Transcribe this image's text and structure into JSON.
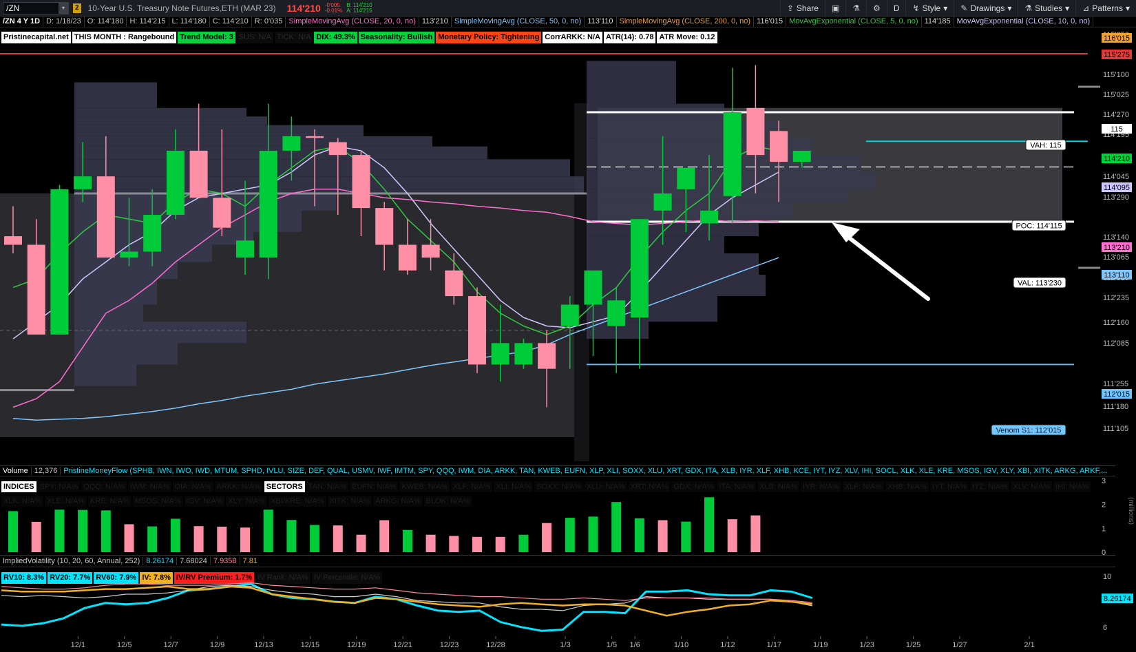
{
  "toolbar": {
    "symbol": "/ZN",
    "link_badge": "2",
    "description": "10-Year U.S. Treasury Note Futures,ETH (MAR 23)",
    "last_price": "114'210",
    "change_net": "-0'005",
    "change_pct": "-0.01%",
    "bid": "B: 114'210",
    "ask": "A: 114'215",
    "buttons": {
      "share": "Share",
      "style": "Style",
      "drawings": "Drawings",
      "studies": "Studies",
      "patterns": "Patterns",
      "interval": "D"
    }
  },
  "studybar": {
    "chart_label": "/ZN 4 Y 1D",
    "date": "D: 1/18/23",
    "open": "O: 114'180",
    "high": "H: 114'215",
    "low": "L: 114'180",
    "close": "C: 114'210",
    "range": "R: 0'035",
    "studies": [
      {
        "label": "SimpleMovingAvg (CLOSE, 20, 0, no)",
        "value": "113'210",
        "color": "#ff6ed0"
      },
      {
        "label": "SimpleMovingAvg (CLOSE, 50, 0, no)",
        "value": "113'110",
        "color": "#7ec8ff"
      },
      {
        "label": "SimpleMovingAvg (CLOSE, 200, 0, no)",
        "value": "116'015",
        "color": "#f0a030"
      },
      {
        "label": "MovAvgExponential (CLOSE, 5, 0, no)",
        "value": "114'185",
        "color": "#2ecc40"
      },
      {
        "label": "MovAvgExponential (CLOSE, 10, 0, no)",
        "value": "",
        "color": "#cfc8ff"
      }
    ]
  },
  "info_labels": [
    {
      "text": "Pristinecapital.net",
      "bg": "#ffffff",
      "fg": "#000000"
    },
    {
      "text": "THIS MONTH : Rangebound",
      "bg": "#ffffff",
      "fg": "#000000"
    },
    {
      "text": "Trend Model: 3",
      "bg": "#00d43c",
      "fg": "#000000"
    },
    {
      "text": "SUS: N/A",
      "bg": "#0b0b0b",
      "fg": "#2a2a2a"
    },
    {
      "text": "TICK: N/A",
      "bg": "#0b0b0b",
      "fg": "#2a2a2a"
    },
    {
      "text": "DIX: 49.3%",
      "bg": "#00d43c",
      "fg": "#000000"
    },
    {
      "text": "Seasonality: Bullish",
      "bg": "#00d43c",
      "fg": "#000000"
    },
    {
      "text": "Monetary Policy: Tightening",
      "bg": "#ff4513",
      "fg": "#000000"
    },
    {
      "text": "CorrARKK: N/A",
      "bg": "#ffffff",
      "fg": "#000000"
    },
    {
      "text": "ATR(14): 0.78",
      "bg": "#ffffff",
      "fg": "#000000"
    },
    {
      "text": "ATR Move: 0.12",
      "bg": "#ffffff",
      "fg": "#000000"
    }
  ],
  "price_axis": {
    "ticks": [
      "115'250",
      "115'175",
      "115'100",
      "115'025",
      "114'270",
      "114'195",
      "114'045",
      "113'290",
      "113'140",
      "113'065",
      "112'310",
      "112'235",
      "112'160",
      "112'085",
      "111'255",
      "111'180",
      "111'105"
    ],
    "badges": [
      {
        "text": "116'015",
        "bg": "#f0a030",
        "fg": "#000000"
      },
      {
        "text": "115'275",
        "bg": "#e23a3a",
        "fg": "#000000"
      },
      {
        "text": "115",
        "bg": "#ffffff",
        "fg": "#000000"
      },
      {
        "text": "114'210",
        "bg": "#00d43c",
        "fg": "#000000"
      },
      {
        "text": "114'095",
        "bg": "#cfc8ff",
        "fg": "#000000"
      },
      {
        "text": "113'210",
        "bg": "#ff6ed0",
        "fg": "#000000"
      },
      {
        "text": "113'110",
        "bg": "#7ec8ff",
        "fg": "#000000"
      },
      {
        "text": "112'015",
        "bg": "#6fc3ff",
        "fg": "#000000"
      }
    ]
  },
  "levels": {
    "vah": "VAH: 115",
    "poc": "POC: 114'115",
    "val": "VAL: 113'230",
    "venom": "Venom S1: 112'015"
  },
  "x_axis": [
    "12/1",
    "12/5",
    "12/7",
    "12/9",
    "12/13",
    "12/15",
    "12/19",
    "12/21",
    "12/23",
    "12/28",
    "1/3",
    "1/5",
    "1/6",
    "1/10",
    "1/12",
    "1/17",
    "1/19",
    "1/23",
    "1/25",
    "1/27",
    "2/1"
  ],
  "volume": {
    "title": "Volume",
    "value": "12,376",
    "moneyflow": "PristineMoneyFlow (SPHB, IWN, IWO, IWD, MTUM, SPHD, IVLU, SIZE, DEF, QUAL, USMV, IWF, IMTM, SPY, QQQ, IWM, DIA, ARKK, TAN, KWEB, EUFN, XLP, XLI, SOXX, XLU, XRT, GDX, ITA, XLB, IYR, XLF, XHB, KCE, IYT, IYZ, XLV, IHI, SOCL, XLK, XLE, KRE, MSOS, IGV, XLY, XBI, XITK, ARKG, ARKF,...",
    "axis": [
      "3",
      "2",
      "1",
      "0"
    ],
    "unit": "(millions)"
  },
  "indices_row": {
    "head": "INDICES",
    "items": [
      "SPY: N/A%",
      "QQQ: N/A%",
      "IWM: N/A%",
      "DIA: N/A%",
      "ARKK: N/A%"
    ]
  },
  "sectors_row": {
    "head": "SECTORS",
    "items": [
      "TAN: N/A%",
      "EUFN: N/A%",
      "KWEB: N/A%",
      "XLF: N/A%",
      "XLI: N/A%",
      "SOXX: N/A%",
      "XLU: N/A%",
      "XRT: N/A%",
      "GDX: N/A%",
      "ITA: N/A%",
      "XLB: N/A%",
      "IYR: N/A%",
      "XLF: N/A%",
      "XHB: N/A%",
      "IYT: N/A%",
      "IYZ: N/A%",
      "XLV: N/A%",
      "IHI: N/A%"
    ]
  },
  "third_row": {
    "items": [
      "XLK: N/A%",
      "XLE: N/A%",
      "KRE: N/A%",
      "MSOS: N/A%",
      "IGV: N/A%",
      "XLY: N/A%",
      "XBI/KRE: N/A%",
      "XITK: N/A%",
      "ARKG: N/A%",
      "BLOK: N/A%"
    ]
  },
  "iv": {
    "title": "ImpliedVolatility (10, 20, 60, Annual, 252)",
    "values": [
      {
        "text": "8.26174",
        "color": "#00e5ff"
      },
      {
        "text": "7.68024",
        "color": "#cccccc"
      },
      {
        "text": "7.9358",
        "color": "#ff8aa0"
      },
      {
        "text": "7.81",
        "color": "#f0b020"
      }
    ],
    "labels": [
      {
        "text": "RV10: 8.3%",
        "bg": "#00e5ff",
        "fg": "#000000"
      },
      {
        "text": "RV20: 7.7%",
        "bg": "#00e5ff",
        "fg": "#000000"
      },
      {
        "text": "RV60: 7.9%",
        "bg": "#00e5ff",
        "fg": "#000000"
      },
      {
        "text": "IV: 7.8%",
        "bg": "#f0b020",
        "fg": "#000000"
      },
      {
        "text": "IV/RV Premium: 1.7%",
        "bg": "#ff1e1e",
        "fg": "#000000"
      },
      {
        "text": "IV Rank: N/A%",
        "bg": "#0b0b0b",
        "fg": "#262626"
      },
      {
        "text": "IV Percentile: N/A%",
        "bg": "#0b0b0b",
        "fg": "#262626"
      }
    ],
    "axis": [
      "10",
      "8.26174",
      "6"
    ]
  },
  "chart_data": [
    {
      "type": "candlestick",
      "title": "/ZN 4 Y 1D",
      "note": "prices in points (decimal of 32nds); values estimated from axis",
      "ylim": [
        111.2,
        115.95
      ],
      "categories": [
        "11/28",
        "11/29",
        "11/30",
        "12/1",
        "12/2",
        "12/5",
        "12/6",
        "12/7",
        "12/8",
        "12/9",
        "12/12",
        "12/13",
        "12/14",
        "12/15",
        "12/16",
        "12/19",
        "12/20",
        "12/21",
        "12/22",
        "12/23",
        "12/27",
        "12/28",
        "12/29",
        "12/30",
        "1/3",
        "1/4",
        "1/5",
        "1/6",
        "1/9",
        "1/10",
        "1/11",
        "1/12",
        "1/13",
        "1/17",
        "1/18"
      ],
      "open": [
        113.55,
        113.45,
        112.4,
        114.1,
        114.25,
        113.3,
        113.37,
        113.8,
        114.55,
        114.0,
        113.3,
        113.3,
        114.55,
        114.72,
        114.65,
        114.5,
        113.88,
        113.45,
        113.45,
        113.15,
        112.85,
        112.05,
        112.05,
        112.3,
        112.5,
        112.75,
        112.5,
        112.6,
        113.85,
        114.1,
        113.7,
        114.02,
        115.05,
        114.78,
        114.42
      ],
      "high": [
        113.9,
        113.75,
        114.15,
        114.65,
        114.72,
        114.0,
        114.1,
        114.8,
        115.1,
        114.8,
        114.2,
        115.1,
        114.95,
        114.8,
        114.7,
        114.55,
        113.95,
        113.75,
        113.75,
        113.35,
        112.95,
        112.75,
        112.35,
        112.45,
        112.85,
        113.05,
        112.95,
        113.7,
        114.72,
        114.3,
        114.5,
        115.52,
        115.55,
        114.9,
        114.42
      ],
      "low": [
        113.35,
        113.0,
        112.4,
        113.95,
        113.75,
        113.2,
        113.2,
        113.75,
        114.0,
        113.55,
        113.1,
        113.05,
        114.2,
        113.9,
        113.8,
        113.55,
        113.15,
        113.1,
        113.15,
        112.75,
        111.95,
        111.85,
        112.0,
        111.55,
        112.0,
        112.15,
        111.95,
        112.0,
        113.45,
        113.6,
        113.5,
        113.7,
        114.05,
        113.95,
        114.35
      ],
      "close": [
        113.45,
        112.4,
        114.1,
        114.25,
        113.3,
        113.37,
        113.8,
        114.55,
        114.0,
        113.65,
        113.5,
        114.55,
        114.72,
        114.7,
        114.5,
        113.88,
        113.45,
        113.15,
        113.3,
        112.85,
        112.05,
        112.3,
        112.3,
        112.0,
        112.75,
        113.15,
        112.8,
        113.75,
        114.05,
        114.35,
        113.85,
        115.0,
        114.5,
        114.42,
        114.55
      ]
    },
    {
      "type": "bar",
      "title": "Volume",
      "ylabel": "(millions)",
      "ylim": [
        0,
        3
      ],
      "values": [
        1.72,
        1.27,
        1.78,
        1.77,
        1.75,
        1.17,
        1.08,
        1.4,
        1.09,
        1.07,
        1.03,
        1.78,
        1.35,
        1.14,
        1.12,
        0.73,
        1.34,
        0.93,
        0.73,
        0.68,
        0.64,
        0.64,
        0.73,
        1.22,
        1.44,
        1.49,
        2.1,
        1.42,
        1.34,
        1.28,
        2.3,
        1.38,
        1.54
      ],
      "colors": [
        "up",
        "down",
        "up",
        "up",
        "up",
        "down",
        "up",
        "up",
        "down",
        "down",
        "down",
        "up",
        "up",
        "up",
        "down",
        "down",
        "down",
        "up",
        "down",
        "down",
        "down",
        "down",
        "up",
        "down",
        "up",
        "up",
        "up",
        "up",
        "down",
        "up",
        "up",
        "down",
        "down"
      ]
    },
    {
      "type": "line",
      "title": "ImpliedVolatility (10, 20, 60, Annual, 252)",
      "ylim": [
        5.5,
        10.5
      ],
      "series": [
        {
          "name": "RV10",
          "color": "#00e5ff",
          "values": [
            6.2,
            6.1,
            6.3,
            6.7,
            7.5,
            7.9,
            7.8,
            7.9,
            8.3,
            8.9,
            9.0,
            9.2,
            9.4,
            8.6,
            8.3,
            8.2,
            8.0,
            7.9,
            8.4,
            8.2,
            7.7,
            7.3,
            7.2,
            7.3,
            6.4,
            6.0,
            5.7,
            5.8,
            7.2,
            7.2,
            7.1,
            8.8,
            8.8,
            8.9,
            8.6,
            8.5,
            8.5,
            8.9,
            8.8,
            8.3
          ]
        },
        {
          "name": "RV20",
          "color": "#cccccc",
          "values": [
            8.5,
            8.4,
            8.5,
            8.4,
            8.3,
            8.4,
            8.6,
            8.6,
            8.7,
            8.9,
            9.2,
            9.3,
            9.2,
            8.9,
            8.7,
            8.6,
            8.4,
            8.4,
            8.6,
            8.4,
            8.1,
            8.0,
            7.9,
            7.9,
            7.6,
            7.4,
            7.4,
            7.3,
            7.7,
            7.8,
            7.9,
            8.4,
            8.3,
            8.3,
            8.2,
            8.2,
            8.2,
            8.2,
            8.0,
            7.68
          ]
        },
        {
          "name": "RV60",
          "color": "#ff8aa0",
          "values": [
            9.2,
            9.1,
            9.0,
            9.0,
            9.1,
            9.3,
            9.4,
            9.4,
            9.3,
            9.3,
            9.3,
            9.4,
            9.5,
            9.3,
            9.2,
            9.1,
            9.0,
            9.0,
            9.1,
            8.9,
            8.7,
            8.6,
            8.5,
            8.4,
            8.4,
            8.3,
            8.2,
            8.2,
            8.3,
            8.2,
            8.1,
            8.3,
            8.3,
            8.3,
            8.3,
            8.2,
            8.2,
            8.2,
            8.1,
            7.94
          ]
        },
        {
          "name": "IV",
          "color": "#f0b020",
          "values": [
            8.9,
            8.8,
            8.8,
            8.8,
            8.9,
            9.0,
            9.0,
            9.1,
            9.2,
            9.0,
            9.0,
            9.2,
            9.1,
            8.6,
            8.4,
            8.2,
            8.0,
            7.9,
            8.3,
            8.2,
            8.0,
            7.8,
            7.7,
            7.6,
            7.8,
            7.9,
            7.8,
            7.7,
            7.8,
            7.8,
            7.7,
            7.3,
            6.9,
            7.2,
            7.4,
            7.7,
            7.8,
            8.1,
            8.0,
            7.81
          ]
        }
      ]
    }
  ]
}
